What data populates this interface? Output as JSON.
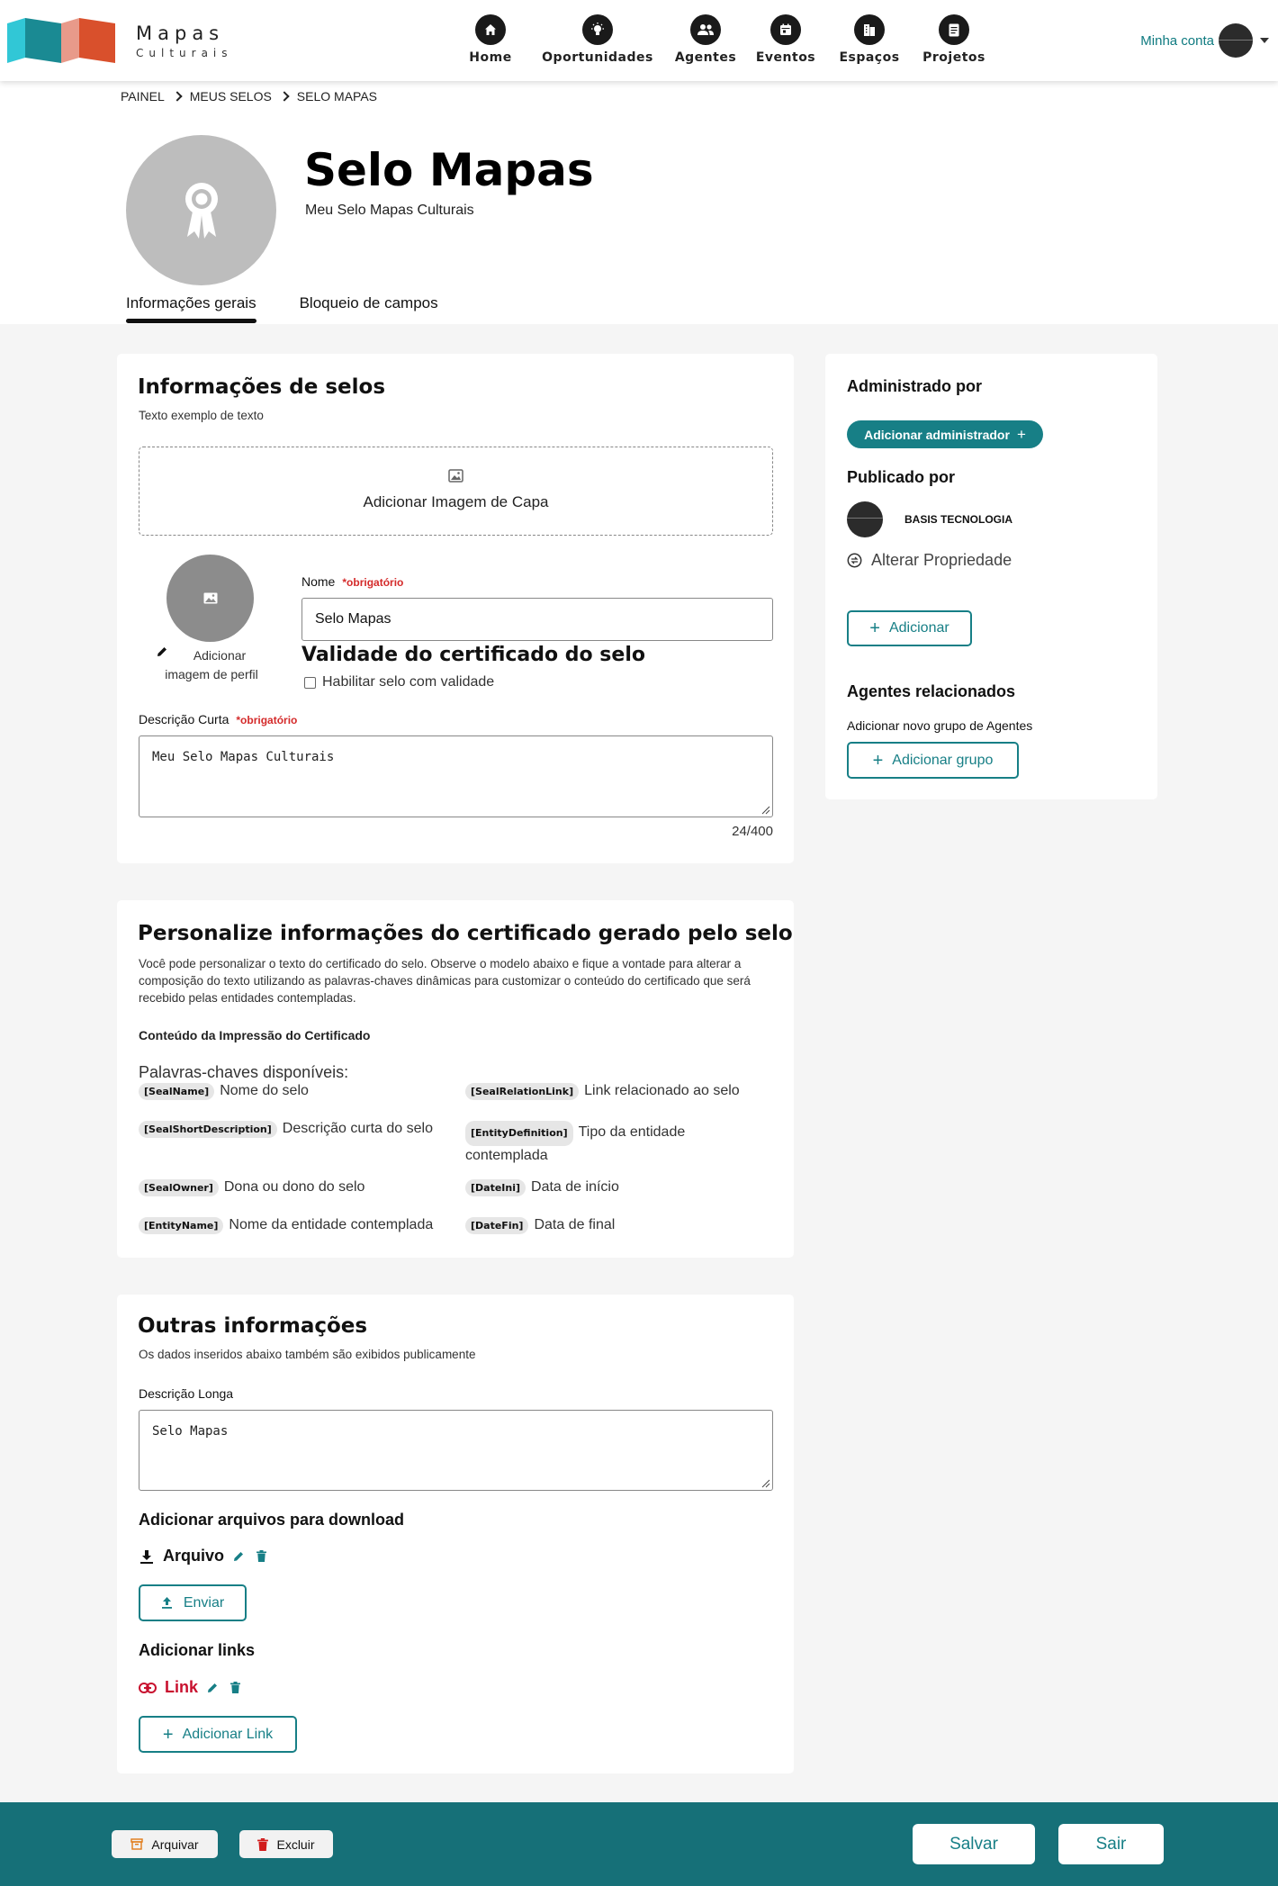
{
  "header": {
    "logo_title": "Mapas",
    "logo_subtitle": "Culturais",
    "nav": [
      {
        "label": "Home",
        "icon": "home-icon"
      },
      {
        "label": "Oportunidades",
        "icon": "lightbulb-icon"
      },
      {
        "label": "Agentes",
        "icon": "people-icon"
      },
      {
        "label": "Eventos",
        "icon": "calendar-icon"
      },
      {
        "label": "Espaços",
        "icon": "building-icon"
      },
      {
        "label": "Projetos",
        "icon": "document-icon"
      }
    ],
    "account_label": "Minha conta"
  },
  "breadcrumb": [
    "Painel",
    "Meus selos",
    "Selo Mapas"
  ],
  "profile": {
    "title": "Selo Mapas",
    "subtitle": "Meu Selo Mapas Culturais"
  },
  "tabs": [
    "Informações gerais",
    "Bloqueio de campos"
  ],
  "info_card": {
    "title": "Informações de selos",
    "subtitle": "Texto exemplo de texto",
    "cover_label": "Adicionar Imagem de Capa",
    "profile_img_label": "Adicionar imagem de perfil",
    "name_label": "Nome",
    "required_label": "*obrigatório",
    "name_value": "Selo Mapas",
    "validity_title": "Validade do certificado do selo",
    "validity_checkbox": "Habilitar selo com validade",
    "short_desc_label": "Descrição Curta",
    "short_desc_value": "Meu Selo Mapas Culturais",
    "char_count": "24/400"
  },
  "certificate_card": {
    "title": "Personalize informações do certificado gerado pelo selo",
    "description": "Você pode personalizar o texto do certificado do selo. Observe o modelo abaixo e fique a vontade para alterar a composição do texto utilizando as palavras-chaves dinâmicas para customizar o conteúdo do certificado que será recebido pelas entidades contempladas.",
    "content_label": "Conteúdo da Impressão do Certificado",
    "keywords_title": "Palavras-chaves disponíveis:",
    "keywords": [
      {
        "tag": "[SealName]",
        "desc": "Nome do selo"
      },
      {
        "tag": "[SealRelationLink]",
        "desc": "Link relacionado ao selo"
      },
      {
        "tag": "[SealShortDescription]",
        "desc": "Descrição curta do selo"
      },
      {
        "tag": "[EntityDefinition]",
        "desc": "Tipo da entidade contemplada"
      },
      {
        "tag": "[SealOwner]",
        "desc": "Dona ou dono do selo"
      },
      {
        "tag": "[DateIni]",
        "desc": "Data de início"
      },
      {
        "tag": "[EntityName]",
        "desc": "Nome da entidade contemplada"
      },
      {
        "tag": "[DateFin]",
        "desc": "Data de final"
      }
    ]
  },
  "other_card": {
    "title": "Outras informações",
    "subtitle": "Os dados inseridos abaixo também são exibidos publicamente",
    "long_desc_label": "Descrição Longa",
    "long_desc_value": "Selo Mapas",
    "files_title": "Adicionar arquivos para download",
    "file_label": "Arquivo",
    "send_button": "Enviar",
    "links_title": "Adicionar links",
    "link_label": "Link",
    "add_link_button": "Adicionar Link"
  },
  "side_card": {
    "admin_title": "Administrado por",
    "add_admin_button": "Adicionar administrador",
    "published_title": "Publicado por",
    "publisher_name": "BASIS TECNOLOGIA",
    "change_owner": "Alterar Propriedade",
    "add_button": "Adicionar",
    "agents_title": "Agentes relacionados",
    "agents_subtitle": "Adicionar novo grupo de Agentes",
    "add_group_button": "Adicionar grupo"
  },
  "footer": {
    "archive_button": "Arquivar",
    "delete_button": "Excluir",
    "save_button": "Salvar",
    "exit_button": "Sair"
  },
  "colors": {
    "accent": "#177f86",
    "footer": "#167078",
    "required": "#d42a2a",
    "link": "#c8102e"
  }
}
